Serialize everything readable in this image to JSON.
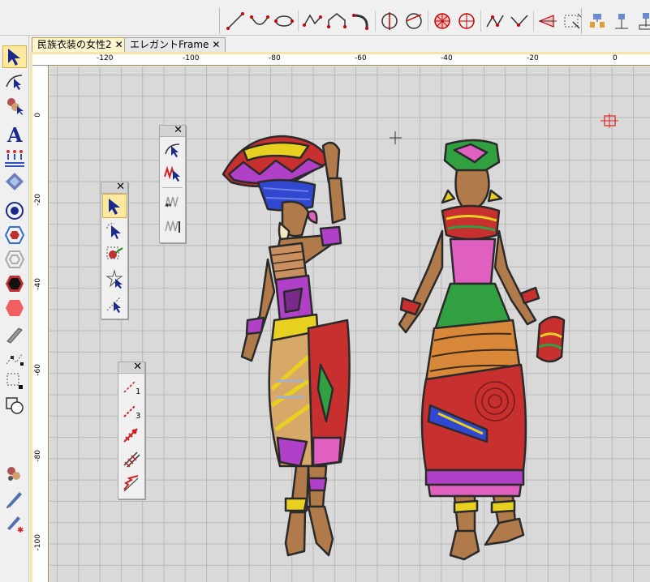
{
  "tabs": [
    {
      "label": "民族衣装の女性2",
      "close": "✕"
    },
    {
      "label": "エレガントFrame",
      "close": "✕"
    }
  ],
  "ruler": {
    "h_labels": [
      "-120",
      "-100",
      "-80",
      "-60",
      "-40",
      "-20",
      "0"
    ],
    "v_labels": [
      "0",
      "-20",
      "-40",
      "-60",
      "-80",
      "-100"
    ]
  },
  "palettes": {
    "close": "✕"
  },
  "palette_line": {
    "labels": [
      "1",
      "3"
    ]
  },
  "colors": {
    "canvas": "#d9d9d9",
    "grid": "#b8b8b8",
    "skin": "#b07a4a",
    "outline": "#2a2a2a",
    "red": "#c83030",
    "purple": "#b040c8",
    "green": "#30a040",
    "yellow": "#e8d020",
    "blue": "#3048d0",
    "orange": "#d88838",
    "pink": "#e060c0"
  },
  "icons": {
    "left_toolbar": [
      "select-arrow-icon",
      "reshape-icon",
      "stitch-color-icon",
      "text-A-icon",
      "people-pattern-icon",
      "diamond-applique-icon",
      "circle-target-icon",
      "hexagon-blue-icon",
      "hexagon-outline-icon",
      "hexagon-black-icon",
      "hexagon-red-icon",
      "knife-icon",
      "stitch-edit-icon",
      "node-select-icon",
      "shape-combine-icon",
      "color-balls-icon",
      "pen-tool-icon",
      "pen-red-icon"
    ]
  }
}
